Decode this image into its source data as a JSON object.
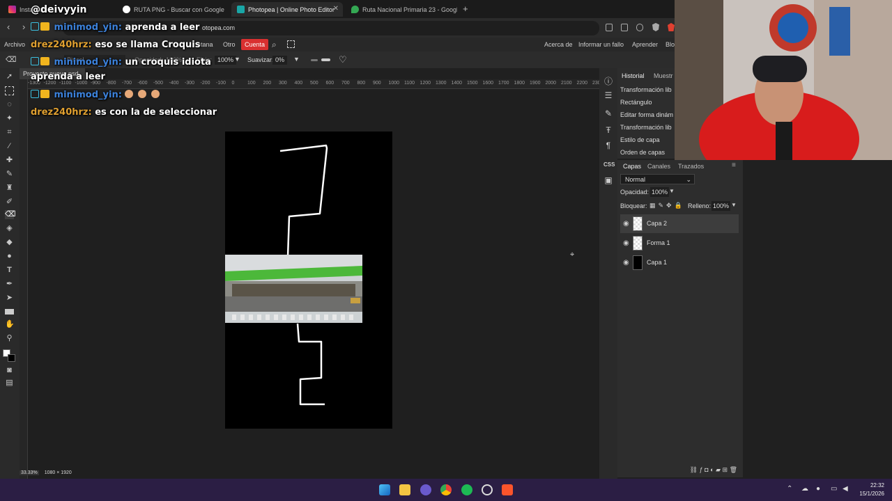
{
  "browser": {
    "tabs": [
      {
        "label": "Instagram",
        "active": false
      },
      {
        "label": "RUTA PNG - Buscar con Google",
        "active": false
      },
      {
        "label": "Photopea | Online Photo Editor",
        "active": true
      },
      {
        "label": "Ruta Nacional Primaria 23 - Google M",
        "active": false
      }
    ],
    "new_tab": "+",
    "url": "otopea.com"
  },
  "overlay": {
    "streamer_handle": "@deivyyin",
    "chat": [
      {
        "user": "minimod_yin:",
        "message": "aprenda a leer"
      },
      {
        "user": "drez240hrz:",
        "message": "eso se llama Croquis"
      },
      {
        "user": "minimod_yin:",
        "message": "un croquis idiota"
      },
      {
        "user": "",
        "message": "aprenda a leer"
      },
      {
        "user": "minimod_yin:",
        "message": ""
      },
      {
        "user": "drez240hrz:",
        "message": "es con la de seleccionar"
      }
    ]
  },
  "menu": {
    "items": [
      "Archivo",
      "ntana",
      "Otro"
    ],
    "account": "Cuenta",
    "right_items": [
      "Acerca de",
      "Informar un fallo",
      "Aprender",
      "Blo"
    ]
  },
  "options": {
    "brush_label": "Pincel",
    "opacity_label": "Opacidad:",
    "opacity_value": "100%",
    "flow_label": "Flujo:",
    "flow_value": "100%",
    "smooth_label": "Suavizar:",
    "smooth_value": "0%"
  },
  "document": {
    "tab_label": "Proyecto nuevo.psd",
    "zoom": "33.33%",
    "size": "1080 × 1920",
    "ruler_labels": [
      "-1300",
      "-1200",
      "-1100",
      "-1000",
      "-900",
      "-800",
      "-700",
      "-600",
      "-500",
      "-400",
      "-300",
      "-200",
      "-100",
      "0",
      "100",
      "200",
      "300",
      "400",
      "500",
      "600",
      "700",
      "800",
      "900",
      "1000",
      "1100",
      "1200",
      "1300",
      "1400",
      "1500",
      "1600",
      "1700",
      "1800",
      "1900",
      "2000",
      "2100",
      "2200",
      "2300"
    ]
  },
  "history": {
    "tabs": [
      "Historial",
      "Muestr"
    ],
    "items": [
      "Transformación lib",
      "Rectángulo",
      "Editar forma dinám",
      "Transformación lib",
      "Estilo de capa",
      "Orden de capas"
    ]
  },
  "layers": {
    "tabs": [
      "Capas",
      "Canales",
      "Trazados"
    ],
    "blend_mode": "Normal",
    "opacity_label": "Opacidad:",
    "opacity_value": "100%",
    "lock_label": "Bloquear:",
    "fill_label": "Relleno:",
    "fill_value": "100%",
    "items": [
      {
        "name": "Capa 2",
        "selected": true
      },
      {
        "name": "Forma 1",
        "selected": false
      },
      {
        "name": "Capa 1",
        "selected": false
      }
    ]
  },
  "side_icons": {
    "css_label": "CSS"
  },
  "taskbar": {
    "time": "22:32",
    "date": "15/1/2026"
  },
  "colors": {
    "accent_red": "#d93030",
    "taskbar": "#2b1e44",
    "chat_user_blue": "#3c82dc",
    "chat_user_orange": "#e0a030"
  }
}
